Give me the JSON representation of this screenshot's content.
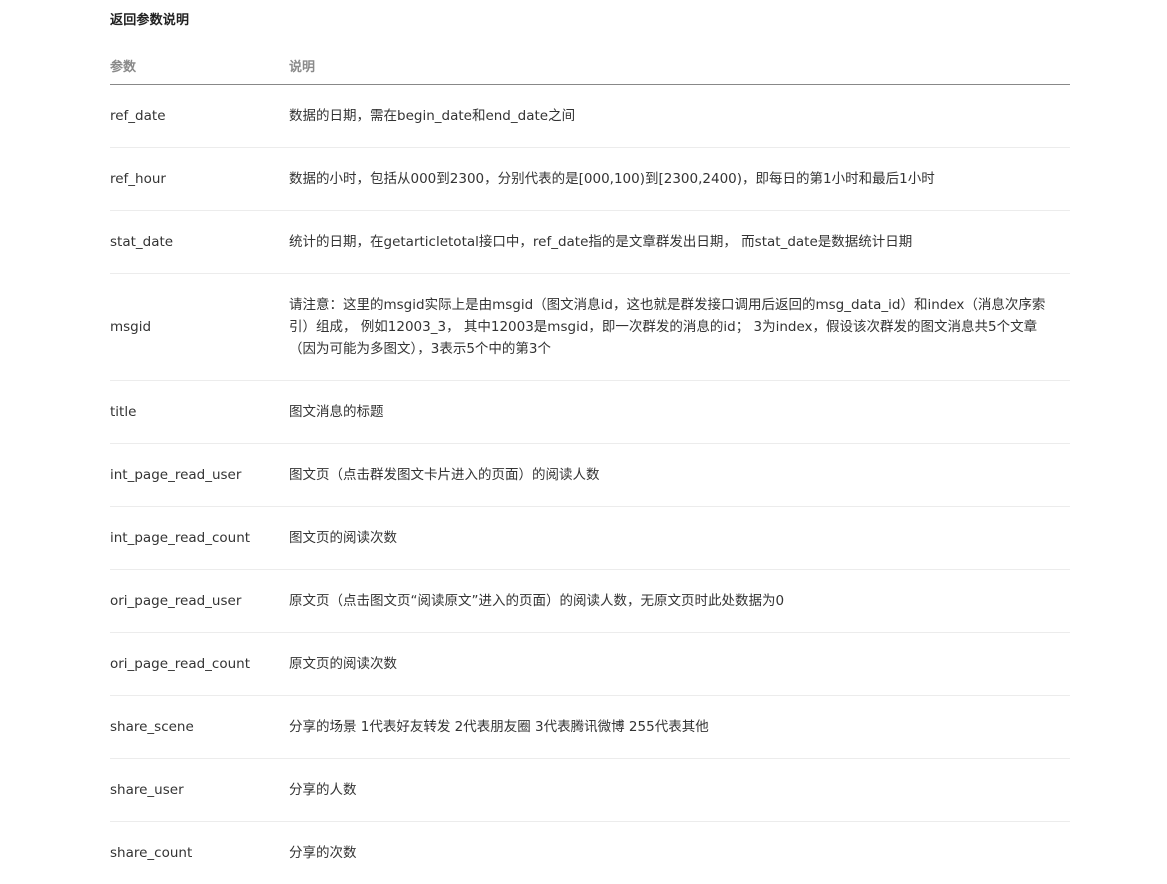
{
  "section_title": "返回参数说明",
  "table": {
    "headers": [
      "参数",
      "说明"
    ],
    "rows": [
      {
        "param": "ref_date",
        "desc": "数据的日期，需在begin_date和end_date之间"
      },
      {
        "param": "ref_hour",
        "desc": "数据的小时，包括从000到2300，分别代表的是[000,100)到[2300,2400)，即每日的第1小时和最后1小时"
      },
      {
        "param": "stat_date",
        "desc": "统计的日期，在getarticletotal接口中，ref_date指的是文章群发出日期， 而stat_date是数据统计日期"
      },
      {
        "param": "msgid",
        "desc": "请注意：这里的msgid实际上是由msgid（图文消息id，这也就是群发接口调用后返回的msg_data_id）和index（消息次序索引）组成， 例如12003_3， 其中12003是msgid，即一次群发的消息的id； 3为index，假设该次群发的图文消息共5个文章（因为可能为多图文），3表示5个中的第3个"
      },
      {
        "param": "title",
        "desc": "图文消息的标题"
      },
      {
        "param": "int_page_read_user",
        "desc": "图文页（点击群发图文卡片进入的页面）的阅读人数"
      },
      {
        "param": "int_page_read_count",
        "desc": "图文页的阅读次数"
      },
      {
        "param": "ori_page_read_user",
        "desc": "原文页（点击图文页“阅读原文”进入的页面）的阅读人数，无原文页时此处数据为0"
      },
      {
        "param": "ori_page_read_count",
        "desc": "原文页的阅读次数"
      },
      {
        "param": "share_scene",
        "desc": "分享的场景 1代表好友转发 2代表朋友圈 3代表腾讯微博 255代表其他"
      },
      {
        "param": "share_user",
        "desc": "分享的人数"
      },
      {
        "param": "share_count",
        "desc": "分享的次数"
      }
    ]
  }
}
